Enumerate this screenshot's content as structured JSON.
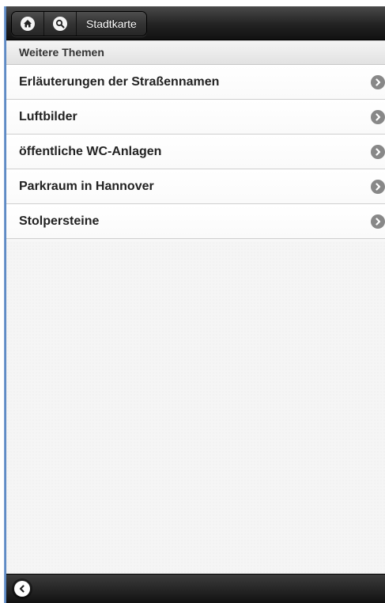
{
  "header": {
    "home_icon": "home-icon",
    "search_icon": "search-icon",
    "title_button_label": "Stadtkarte"
  },
  "divider": {
    "label": "Weitere Themen"
  },
  "list": {
    "items": [
      {
        "label": "Erläuterungen der Straßennamen",
        "icon": "chevron-right-icon"
      },
      {
        "label": "Luftbilder",
        "icon": "chevron-right-icon"
      },
      {
        "label": "öffentliche WC-Anlagen",
        "icon": "chevron-right-icon"
      },
      {
        "label": "Parkraum in Hannover",
        "icon": "chevron-right-icon"
      },
      {
        "label": "Stolpersteine",
        "icon": "chevron-right-icon"
      }
    ]
  },
  "footer": {
    "back_icon": "chevron-left-icon"
  },
  "colors": {
    "header_bg": "#222222",
    "list_text": "#222222",
    "arrow_bg": "#888888"
  }
}
